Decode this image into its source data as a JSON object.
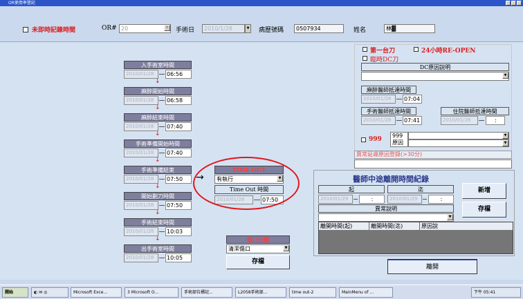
{
  "window": {
    "title": "OR使用率登記"
  },
  "toolbar": {
    "realtime_label": "未即時記錄時間",
    "or_label": "OR#",
    "or_value": "20",
    "surgery_date_label": "手術日",
    "surgery_date_value": "2010/1/28",
    "chart_no_label": "病歷號碼",
    "chart_no_value": "0507934",
    "name_label": "姓名",
    "name_value": "林▓"
  },
  "timeline": [
    {
      "label": "入手術室時間",
      "date": "2010/01/28",
      "time": "06:56"
    },
    {
      "label": "麻醉開始時間",
      "date": "2010/01/28",
      "time": "06:58"
    },
    {
      "label": "麻醉結束時間",
      "date": "2010/01/28",
      "time": "07:40"
    },
    {
      "label": "手術準備開始時間",
      "date": "2010/01/28",
      "time": "07:40"
    },
    {
      "label": "手術準備結束",
      "date": "2010/01/28",
      "time": "07:50"
    },
    {
      "label": "開始劃刀時間",
      "date": "2010/01/28",
      "time": "07:50"
    },
    {
      "label": "手術結束時間",
      "date": "2010/01/28",
      "time": "10:03"
    },
    {
      "label": "出手術室時間",
      "date": "2010/01/28",
      "time": "10:05"
    }
  ],
  "timeout": {
    "header": "TIME OUT",
    "select_value": "有執行",
    "time_label": "Time Out 時間",
    "date": "2010/01/28",
    "time": "07:50"
  },
  "wound": {
    "header": "傷口分類",
    "select_value": "清潔傷口",
    "save_label": "存檔"
  },
  "right": {
    "first_case_label": "第一台刀",
    "reopen_label": "24小時RE-OPEN",
    "temp_dc_label": "臨時DC刀",
    "dc_reason_header": "DC原因說明",
    "anesth_arrive_label": "麻醉醫師抵達時間",
    "anesth_arrive_date": "2010/01/28",
    "anesth_arrive_time": "07:04",
    "surgeon_arrive_label": "手術醫師抵達時間",
    "surgeon_arrive_date": "2010/01/28",
    "surgeon_arrive_time": "07:41",
    "resident_arrive_label": "住院醫師抵達時間",
    "resident_arrive_date": "2010/01/28",
    "resident_arrive_time": ":",
    "code999_label": "999",
    "code999_num": "999",
    "code999_reason": "原因",
    "abnormal_reason_label": "異常延遲原因登錄(>30分)"
  },
  "leave": {
    "title": "醫師中途離開時間紀錄",
    "start_label": "起",
    "end_label": "迄",
    "start_date": "2010/01/29",
    "start_time": ":",
    "end_date": "2010/01/29",
    "end_time": ":",
    "abnormal_label": "異常說明",
    "add_label": "新增",
    "save1_label": "存檔",
    "save2_label": "存檔",
    "col_start": "離開時間(起)",
    "col_end": "離開時間(迄)",
    "col_reason": "原因說",
    "exit_label": "離開"
  },
  "taskbar": {
    "start_label": "開始",
    "clock": "下午 05:41",
    "items": [
      "Microsoft Exce...",
      "3 Microsoft O...",
      "手術部位標記...",
      "L2058手術部...",
      "time out-2",
      "MainMenu of ..."
    ]
  },
  "colors": {
    "accent_red": "#d81e1e",
    "header_gray": "#7e7e9e",
    "circle_red": "#e0161b"
  }
}
